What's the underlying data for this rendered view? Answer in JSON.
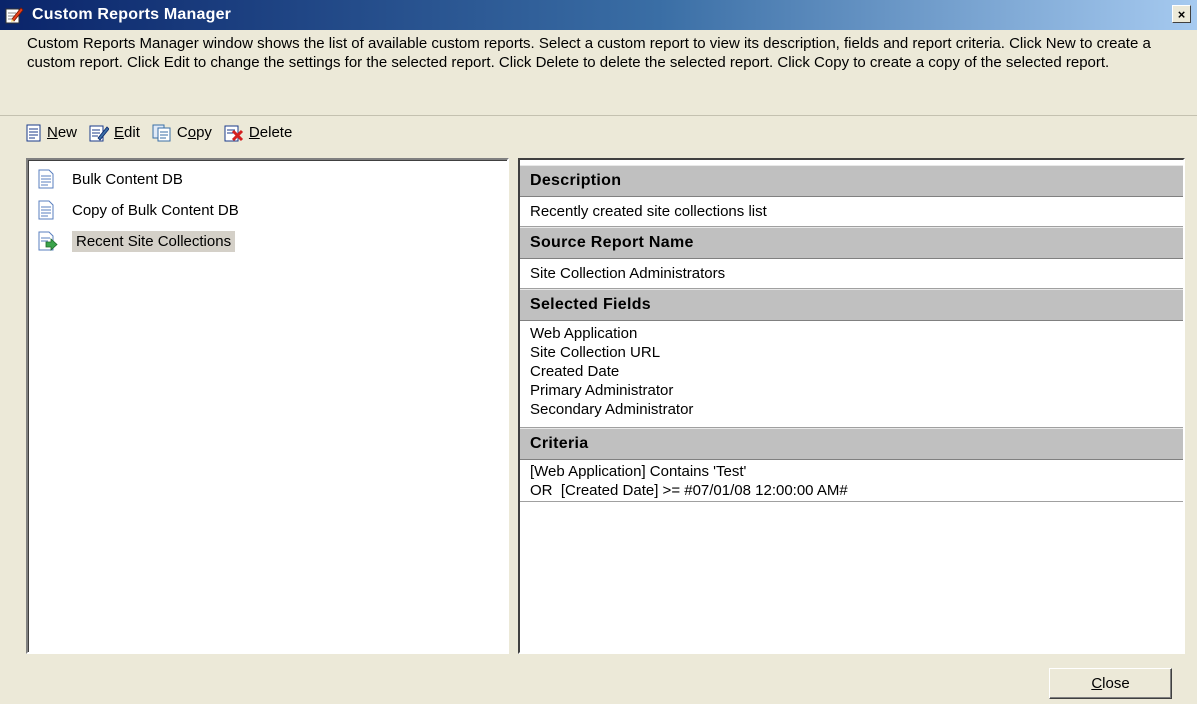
{
  "window": {
    "title": "Custom Reports Manager",
    "close_glyph": "×"
  },
  "description": "Custom Reports Manager window shows the list of available custom reports. Select a custom report to view its description, fields and report criteria. Click New to create a custom report. Click Edit to change the settings for the selected report. Click Delete to delete the selected report. Click Copy to create a copy of the selected report.",
  "toolbar": {
    "new": {
      "accel": "N",
      "rest": "ew",
      "icon": "new-report-icon"
    },
    "edit": {
      "accel": "E",
      "rest": "dit",
      "icon": "edit-report-icon"
    },
    "copy": {
      "pre": "C",
      "accel": "o",
      "rest": "py",
      "icon": "copy-report-icon"
    },
    "delete": {
      "accel": "D",
      "rest": "elete",
      "icon": "delete-report-icon"
    }
  },
  "reports": [
    {
      "label": "Bulk Content DB",
      "icon": "report-icon",
      "selected": false
    },
    {
      "label": "Copy of Bulk Content DB",
      "icon": "report-icon",
      "selected": false
    },
    {
      "label": "Recent Site Collections",
      "icon": "report-arrow-icon",
      "selected": true
    }
  ],
  "details": {
    "description_header": "Description",
    "description_value": "Recently created site collections list",
    "source_header": "Source Report Name",
    "source_value": "Site Collection Administrators",
    "fields_header": "Selected Fields",
    "fields": [
      "Web Application",
      "Site Collection URL",
      "Created Date",
      "Primary Administrator",
      "Secondary Administrator"
    ],
    "criteria_header": "Criteria",
    "criteria": [
      "[Web Application] Contains 'Test'",
      "OR  [Created Date] >= #07/01/08 12:00:00 AM#"
    ]
  },
  "close_button": {
    "accel": "C",
    "rest": "lose"
  },
  "colors": {
    "window_bg": "#ece9d8",
    "titlebar_start": "#0a246a",
    "titlebar_end": "#a6caf0",
    "section_header_bg": "#c0c0c0",
    "selection_bg": "#d4d0c8"
  }
}
